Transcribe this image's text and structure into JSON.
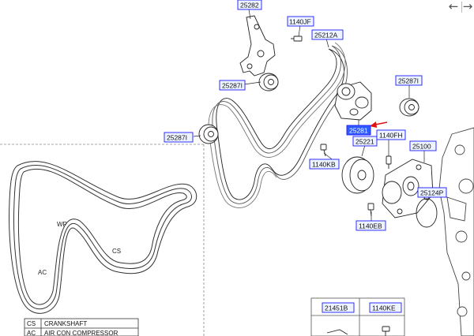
{
  "nav": {
    "back_icon": "arrow-left-icon",
    "back_glyph": "←",
    "forward_icon": "arrow-right-icon",
    "forward_glyph": "→"
  },
  "parts": {
    "bracket": "25282",
    "bolt_top": "1140JF",
    "belt_main": "25212A",
    "idler_left_upper": "25287I",
    "idler_right": "25287I",
    "tensioner": "25281",
    "idler_left_lower": "25287I",
    "pulley": "25221",
    "bolt_fh": "1140FH",
    "pump": "25100",
    "bolt_kb": "1140KB",
    "gasket": "25124P",
    "bolt_eb": "1140EB"
  },
  "routing": {
    "wp": "WP",
    "cs": "CS",
    "ac": "AC"
  },
  "legend": [
    {
      "code": "CS",
      "name": "CRANKSHAFT"
    },
    {
      "code": "AC",
      "name": "AIR CON COMPRESSOR"
    }
  ],
  "bottom_table": {
    "col1": "21451B",
    "col2": "1140KE"
  },
  "colors": {
    "label_border": "#1a1aff",
    "label_fill": "#eef4ff",
    "highlight_fill": "#2f5cff",
    "arrow": "#e01010",
    "line": "#222222"
  }
}
